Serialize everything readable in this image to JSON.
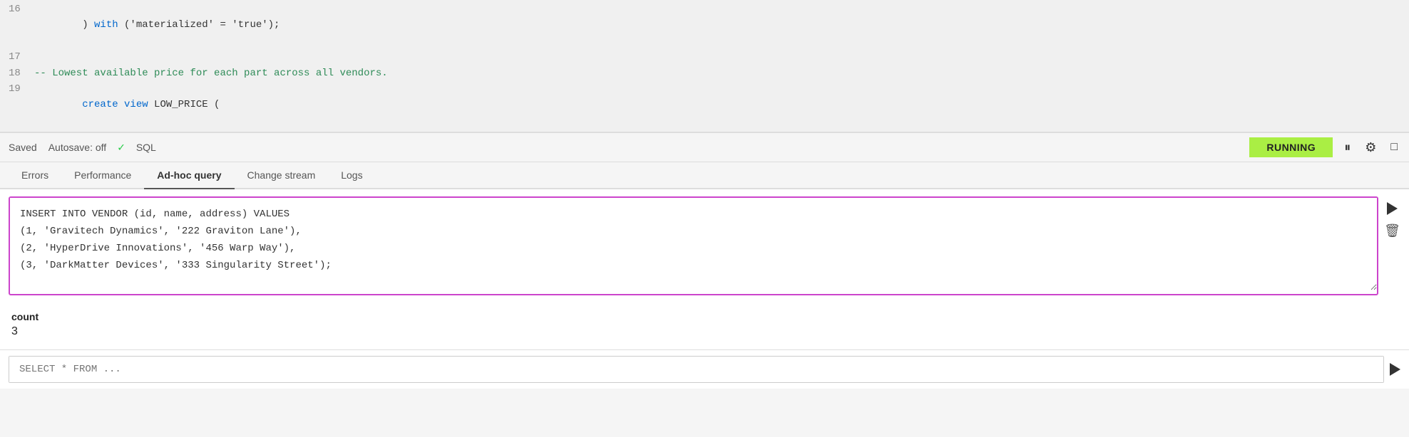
{
  "code_lines": [
    {
      "num": "16",
      "parts": [
        {
          "text": ") ",
          "class": ""
        },
        {
          "text": "with",
          "class": "kw-blue"
        },
        {
          "text": " ('materialized' = 'true');",
          "class": ""
        }
      ]
    },
    {
      "num": "17",
      "parts": []
    },
    {
      "num": "18",
      "parts": [
        {
          "text": "-- Lowest available price for each part across all vendors.",
          "class": "kw-comment"
        }
      ]
    },
    {
      "num": "19",
      "parts": [
        {
          "text": "create view",
          "class": "kw-blue"
        },
        {
          "text": " LOW_PRICE (",
          "class": ""
        }
      ]
    }
  ],
  "toolbar": {
    "saved_label": "Saved",
    "autosave_label": "Autosave: off",
    "sql_label": "SQL",
    "running_label": "RUNNING"
  },
  "tabs": [
    {
      "label": "Errors",
      "active": false
    },
    {
      "label": "Performance",
      "active": false
    },
    {
      "label": "Ad-hoc query",
      "active": true
    },
    {
      "label": "Change stream",
      "active": false
    },
    {
      "label": "Logs",
      "active": false
    }
  ],
  "query_block": {
    "sql": "INSERT INTO VENDOR (id, name, address) VALUES\n(1, 'Gravitech Dynamics', '222 Graviton Lane'),\n(2, 'HyperDrive Innovations', '456 Warp Way'),\n(3, 'DarkMatter Devices', '333 Singularity Street');"
  },
  "results": {
    "label": "count",
    "value": "3"
  },
  "bottom_query": {
    "placeholder": "SELECT * FROM ..."
  },
  "icons": {
    "run": "▶",
    "pause": "⏸",
    "settings": "⚙",
    "expand": "□",
    "delete": "🗑"
  }
}
